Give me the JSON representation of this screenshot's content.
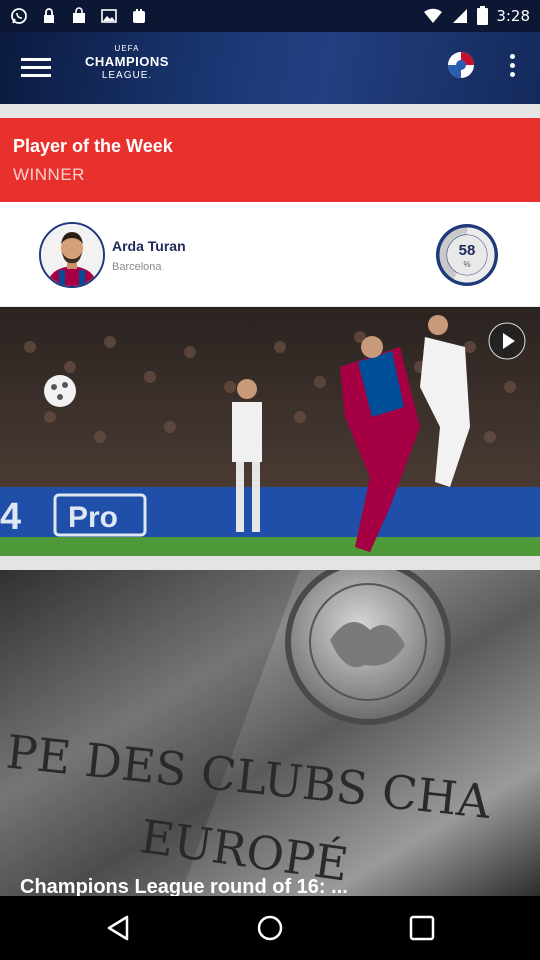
{
  "status_bar": {
    "time": "3:28",
    "left_icons": [
      "whatsapp-icon",
      "lock-icon",
      "shopping-bag-icon",
      "image-icon",
      "store-icon"
    ],
    "right_icons": [
      "wifi-icon",
      "signal-icon",
      "battery-icon"
    ]
  },
  "app_bar": {
    "logo": {
      "top": "UEFA",
      "main": "CHAMPIONS",
      "sub": "LEAGUE."
    },
    "menu_icon": "hamburger-menu-icon",
    "club_icon": "club-crest-icon",
    "more_icon": "more-vertical-icon"
  },
  "player_of_week": {
    "title": "Player of the Week",
    "subtitle": "WINNER",
    "player_name": "Arda Turan",
    "club": "Barcelona",
    "vote_value": "58",
    "vote_unit": "%",
    "vote_fraction": 0.58
  },
  "media": {
    "video_banner_text": "Pro",
    "play_icon": "play-icon",
    "photo_caption": "Champions League round of 16: ..."
  },
  "nav_bar": {
    "icons": [
      "back-icon",
      "home-icon",
      "recents-icon"
    ]
  },
  "colors": {
    "header_red": "#e8302d",
    "navy": "#1d2a5a",
    "app_bar": "#1c3a78"
  }
}
